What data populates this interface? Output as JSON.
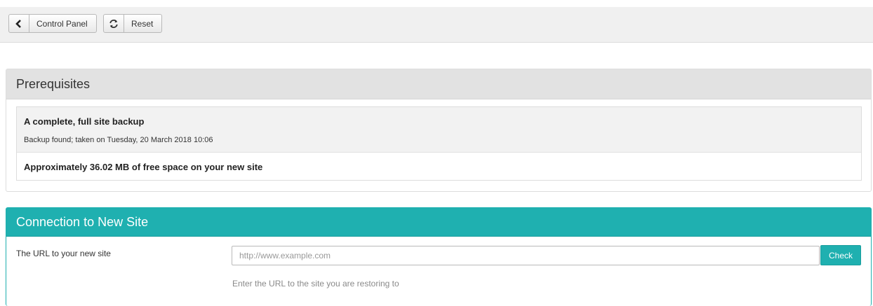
{
  "toolbar": {
    "control_panel_label": "Control Panel",
    "reset_label": "Reset"
  },
  "prerequisites": {
    "title": "Prerequisites",
    "items": [
      {
        "heading": "A complete, full site backup",
        "detail": "Backup found; taken on Tuesday, 20 March 2018 10:06"
      },
      {
        "heading": "Approximately 36.02 MB of free space on your new site"
      }
    ]
  },
  "connection": {
    "title": "Connection to New Site",
    "url_label": "The URL to your new site",
    "url_value": "",
    "url_placeholder": "http://www.example.com",
    "check_label": "Check",
    "help_text": "Enter the URL to the site you are restoring to"
  },
  "colors": {
    "accent": "#1fb0b0",
    "panel_header": "#e2e2e2",
    "toolbar_bg": "#f0f0f0"
  },
  "icons": {
    "back": "chevron-left-icon",
    "reset": "refresh-icon"
  }
}
